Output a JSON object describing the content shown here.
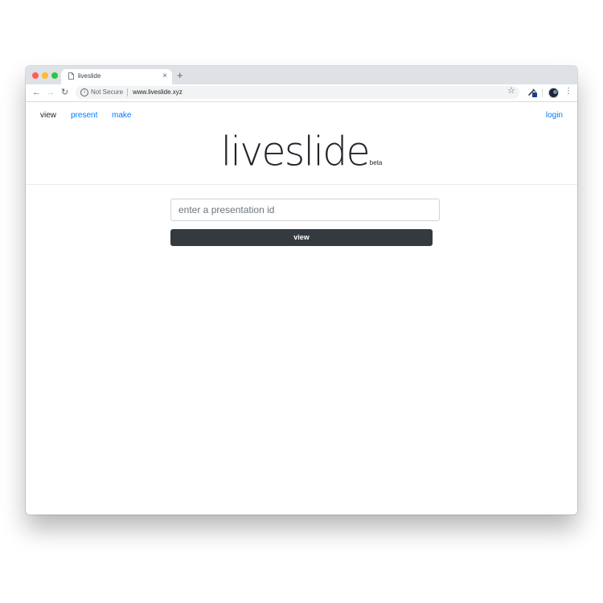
{
  "browser": {
    "tab_title": "liveslide",
    "tab_close": "×",
    "new_tab": "+",
    "security_label": "Not Secure",
    "url": "www.liveslide.xyz",
    "back": "←",
    "forward": "→",
    "reload": "↻",
    "star": "☆",
    "menu": "⋮",
    "info": "i"
  },
  "nav": {
    "view": "view",
    "present": "present",
    "make": "make",
    "login": "login"
  },
  "brand": {
    "name": "liveslide",
    "badge": "beta"
  },
  "search": {
    "placeholder": "enter a presentation id",
    "value": ""
  },
  "actions": {
    "view_label": "view"
  },
  "colors": {
    "link": "#007bff",
    "button": "#343a40",
    "text": "#212529"
  }
}
